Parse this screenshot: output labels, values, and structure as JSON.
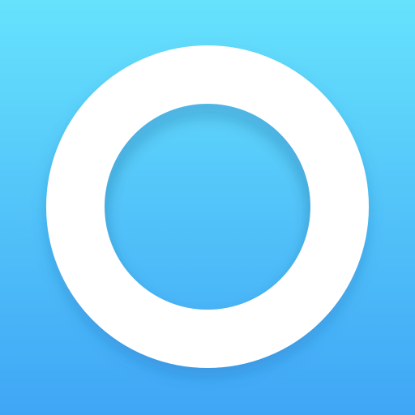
{
  "icon": {
    "name": "ring-icon",
    "colors": {
      "gradient_top": "#66E2FC",
      "gradient_bottom": "#3FA6F6",
      "ring": "#FFFFFF",
      "shadow": "#1E5FA8"
    }
  }
}
